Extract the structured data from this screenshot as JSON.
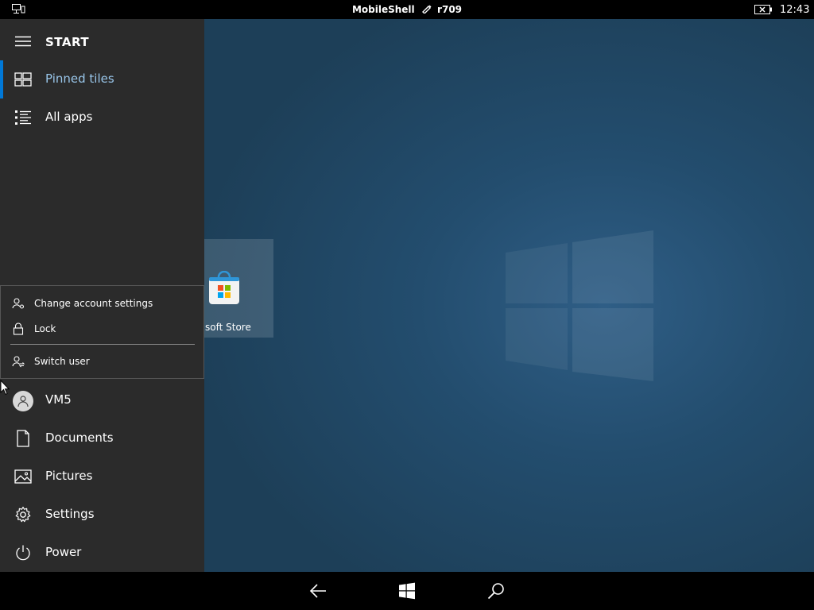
{
  "status_bar": {
    "app_title": "MobileShell",
    "build": "r709",
    "time": "12:43"
  },
  "start_menu": {
    "title": "START",
    "nav": [
      {
        "label": "Pinned tiles",
        "icon": "tiles-icon",
        "active": true
      },
      {
        "label": "All apps",
        "icon": "list-icon",
        "active": false
      }
    ],
    "account_flyout": [
      {
        "label": "Change account settings",
        "icon": "account-settings-icon"
      },
      {
        "label": "Lock",
        "icon": "lock-icon"
      },
      {
        "label": "Switch user",
        "icon": "switch-user-icon"
      }
    ],
    "user": {
      "label": "VM5",
      "icon": "avatar-icon"
    },
    "bottom_items": [
      {
        "label": "Documents",
        "icon": "document-icon"
      },
      {
        "label": "Pictures",
        "icon": "pictures-icon"
      },
      {
        "label": "Settings",
        "icon": "gear-icon"
      },
      {
        "label": "Power",
        "icon": "power-icon"
      }
    ]
  },
  "tiles": [
    {
      "label": "soft Store",
      "icon": "store-icon"
    }
  ],
  "colors": {
    "accent": "#0078d7",
    "pane_bg": "#2b2b2b",
    "desktop_bg": "#234d6e"
  }
}
